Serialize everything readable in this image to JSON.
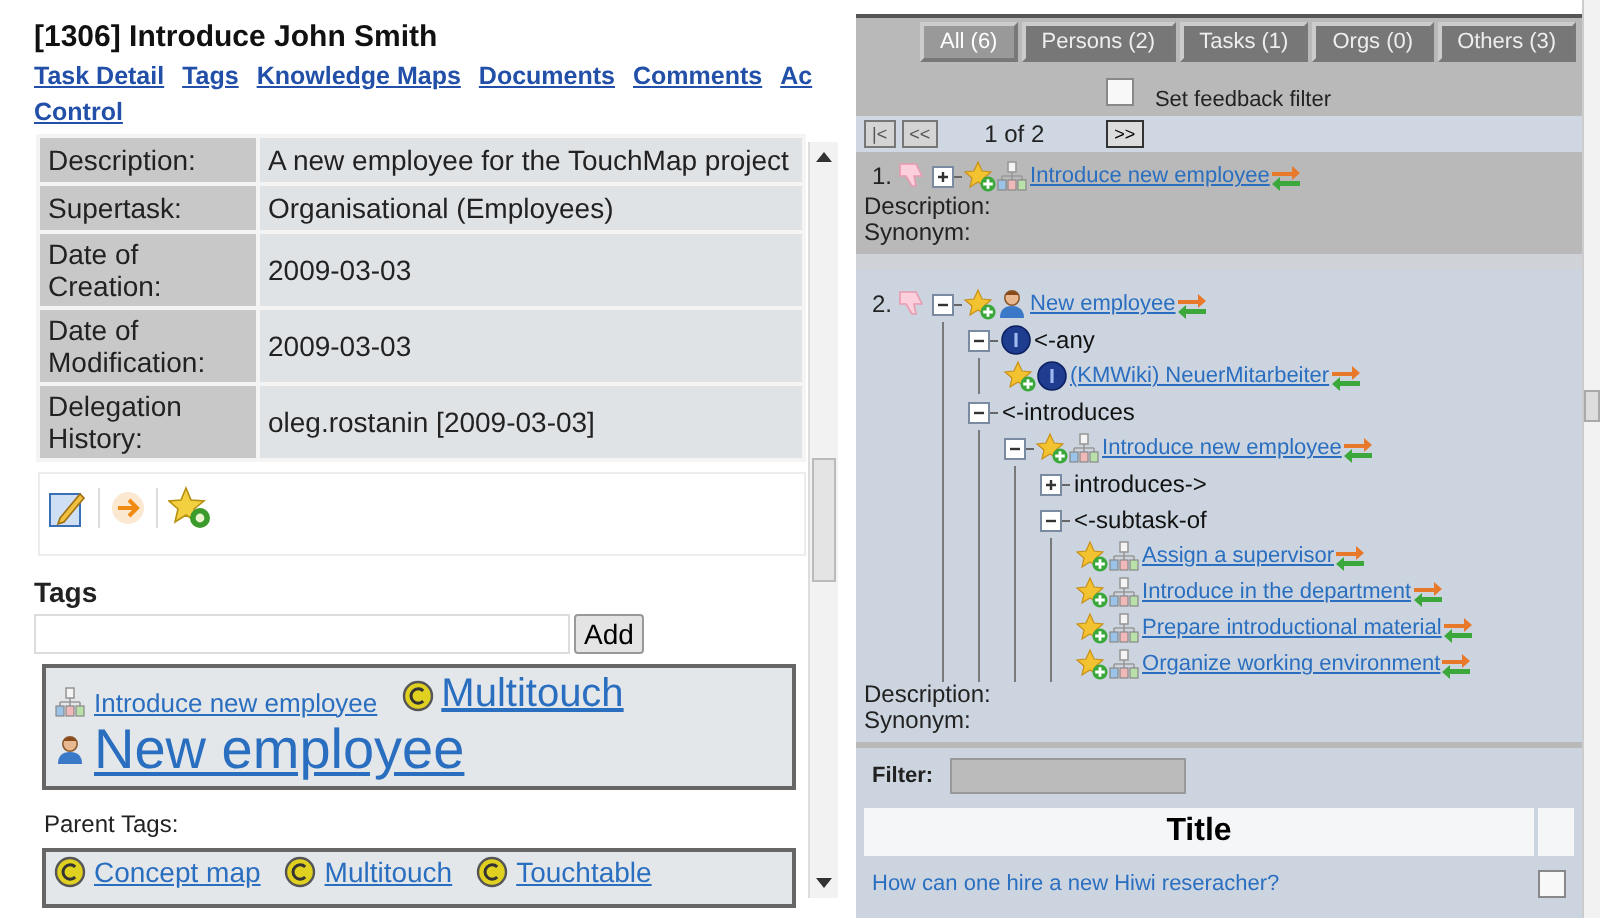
{
  "task": {
    "title": "[1306] Introduce John Smith",
    "nav_lines": [
      [
        {
          "label": "Task Detail"
        },
        {
          "label": "Tags"
        },
        {
          "label": "Knowledge Maps"
        },
        {
          "label": "Documents"
        },
        {
          "label": "Comments"
        },
        {
          "label": "Ac"
        }
      ],
      [
        {
          "label": "Control"
        }
      ]
    ],
    "details": [
      {
        "label": "Description:",
        "value": "A new employee for the TouchMap project"
      },
      {
        "label": "Supertask:",
        "value": "Organisational (Employees)"
      },
      {
        "label": "Date of Creation:",
        "value": "2009-03-03"
      },
      {
        "label": "Date of Modification:",
        "value": "2009-03-03"
      },
      {
        "label": "Delegation History:",
        "value": "oleg.rostanin [2009-03-03]"
      }
    ]
  },
  "tags": {
    "heading": "Tags",
    "add_button": "Add",
    "items": [
      {
        "kind": "task-small",
        "label": "Introduce new employee"
      },
      {
        "kind": "concept-medium",
        "label": "Multitouch"
      },
      {
        "kind": "person-large",
        "label": "New employee"
      }
    ],
    "parent_heading": "Parent Tags:",
    "parents": [
      {
        "kind": "concept",
        "label": "Concept map"
      },
      {
        "kind": "concept",
        "label": "Multitouch"
      },
      {
        "kind": "concept",
        "label": "Touchtable"
      }
    ]
  },
  "filter_tabs": [
    {
      "label": "All (6)",
      "selected": true
    },
    {
      "label": "Persons (2)",
      "selected": false
    },
    {
      "label": "Tasks (1)",
      "selected": false
    },
    {
      "label": "Orgs (0)",
      "selected": false
    },
    {
      "label": "Others (3)",
      "selected": false
    }
  ],
  "feedback_filter": {
    "label": "Set feedback filter",
    "checked": false
  },
  "pager": {
    "buttons_before": [
      {
        "label": "|<",
        "disabled": true
      },
      {
        "label": "<<",
        "disabled": true
      }
    ],
    "text": "1 of 2",
    "buttons_after": [
      {
        "label": ">>",
        "disabled": false
      }
    ]
  },
  "results": [
    {
      "number": "1.",
      "tree": {
        "kind": "task-entity",
        "label": "Introduce new employee",
        "expanded": false
      },
      "description_label": "Description:",
      "synonym_label": "Synonym:"
    },
    {
      "number": "2.",
      "tree": {
        "kind": "person-entity",
        "label": "New employee",
        "expanded": true,
        "children": [
          {
            "kind": "info-relation",
            "label": "<-any",
            "expanded": true,
            "children": [
              {
                "kind": "info-entity",
                "label": "(KMWiki) NeuerMitarbeiter"
              }
            ]
          },
          {
            "kind": "relation",
            "label": "<-introduces",
            "expanded": true,
            "children": [
              {
                "kind": "task-entity",
                "label": "Introduce new employee",
                "expanded": true,
                "children": [
                  {
                    "kind": "relation",
                    "label": "introduces->",
                    "expanded": false
                  },
                  {
                    "kind": "relation",
                    "label": "<-subtask-of",
                    "expanded": true,
                    "children": [
                      {
                        "kind": "task-entity",
                        "label": "Assign a supervisor"
                      },
                      {
                        "kind": "task-entity",
                        "label": "Introduce in the department"
                      },
                      {
                        "kind": "task-entity",
                        "label": "Prepare introductional material"
                      },
                      {
                        "kind": "task-entity",
                        "label": "Organize working environment"
                      }
                    ]
                  }
                ]
              }
            ]
          }
        ]
      },
      "description_label": "Description:",
      "synonym_label": "Synonym:"
    }
  ],
  "filter": {
    "label": "Filter:"
  },
  "table": {
    "columns": [
      "Title"
    ],
    "rows": [
      {
        "title": "How can one hire a new Hiwi reseracher?",
        "checked": false
      }
    ]
  }
}
